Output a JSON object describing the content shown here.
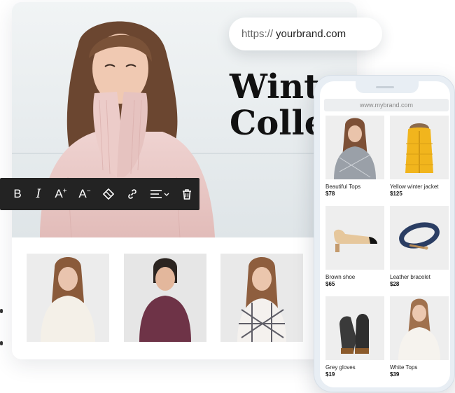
{
  "url_pill": {
    "protocol": "https://",
    "domain": "yourbrand.com"
  },
  "hero": {
    "title": "Winter\nCollec"
  },
  "toolbar": {
    "buttons": [
      {
        "name": "bold-icon",
        "glyph": "B"
      },
      {
        "name": "italic-icon",
        "glyph": "I"
      },
      {
        "name": "font-increase-icon",
        "glyph": "A+"
      },
      {
        "name": "font-decrease-icon",
        "glyph": "A−"
      },
      {
        "name": "eraser-icon",
        "glyph": "◇"
      },
      {
        "name": "link-icon",
        "glyph": "link"
      },
      {
        "name": "align-dropdown-icon",
        "glyph": "align"
      },
      {
        "name": "trash-icon",
        "glyph": "trash"
      }
    ]
  },
  "phone": {
    "url": "www.mybrand.com",
    "products": [
      {
        "name": "Beautiful Tops",
        "price": "$78"
      },
      {
        "name": "Yellow winter jacket",
        "price": "$125"
      },
      {
        "name": "Brown shoe",
        "price": "$65"
      },
      {
        "name": "Leather bracelet",
        "price": "$28"
      },
      {
        "name": "Grey gloves",
        "price": "$19"
      },
      {
        "name": "White Tops",
        "price": "$39"
      }
    ]
  },
  "colors": {
    "toolbar_bg": "#232323",
    "sweater_pink": "#e8c8c6",
    "jacket_yellow": "#f1b51d",
    "bracelet_navy": "#2a3d63"
  }
}
